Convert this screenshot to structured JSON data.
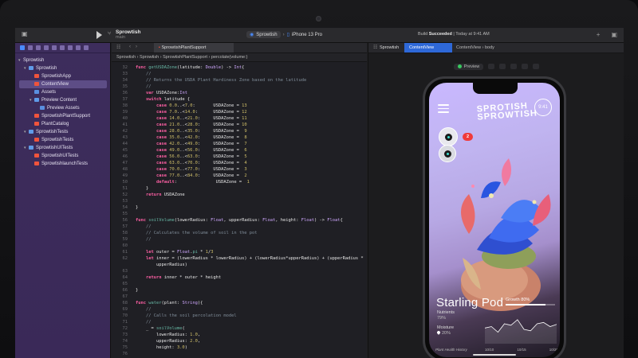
{
  "toolbar": {
    "project_name": "Sprowtish",
    "branch": "main",
    "scheme_target": "Sprowtish",
    "device": "iPhone 13 Pro",
    "status_prefix": "Build",
    "status_bold": "Succeeded",
    "status_suffix": "| Today at 9:41 AM"
  },
  "navigator": {
    "items": [
      {
        "label": "Sprowtish",
        "depth": 0,
        "icon": "project-icon",
        "disclosure": "▾"
      },
      {
        "label": "Sprowtish",
        "depth": 1,
        "icon": "folder-icon",
        "disclosure": "▾"
      },
      {
        "label": "SprowtishApp",
        "depth": 2,
        "icon": "swift-file-icon",
        "disclosure": ""
      },
      {
        "label": "ContentView",
        "depth": 2,
        "icon": "swift-file-icon",
        "disclosure": "",
        "selected": true
      },
      {
        "label": "Assets",
        "depth": 2,
        "icon": "assets-icon",
        "disclosure": ""
      },
      {
        "label": "Preview Content",
        "depth": 2,
        "icon": "folder-icon",
        "disclosure": "▾"
      },
      {
        "label": "Preview Assets",
        "depth": 3,
        "icon": "assets-icon",
        "disclosure": ""
      },
      {
        "label": "SprowtishPlantSupport",
        "depth": 2,
        "icon": "swift-file-icon",
        "disclosure": ""
      },
      {
        "label": "PlantCatalog",
        "depth": 2,
        "icon": "swift-file-icon",
        "disclosure": ""
      },
      {
        "label": "SprowtishTests",
        "depth": 1,
        "icon": "folder-icon",
        "disclosure": "▾"
      },
      {
        "label": "SprowtishTests",
        "depth": 2,
        "icon": "swift-file-icon",
        "disclosure": ""
      },
      {
        "label": "SprowtishUITests",
        "depth": 1,
        "icon": "folder-icon",
        "disclosure": "▾"
      },
      {
        "label": "SprowtishUITests",
        "depth": 2,
        "icon": "swift-file-icon",
        "disclosure": ""
      },
      {
        "label": "SprowtishlaunchTests",
        "depth": 2,
        "icon": "swift-file-icon",
        "disclosure": ""
      }
    ]
  },
  "editor": {
    "tab_label": "SprowtishPlantSupport",
    "jumpbar": "Sprowtish  ›  Sprowtish  ›  SprowtishPlantSupport  ›  percolate(volume:)",
    "lines": [
      {
        "n": "32",
        "html": "<span class='kw'>func</span> <span class='fn'>getUSDAZone</span>(latitude: <span class='ty'>Double</span>) -> <span class='ty'>Int</span>{"
      },
      {
        "n": "33",
        "html": "    <span class='cmt'>//</span>"
      },
      {
        "n": "34",
        "html": "    <span class='cmt'>// Returns the USDA Plant Hardiness Zone based on the latitude</span>"
      },
      {
        "n": "35",
        "html": "    <span class='cmt'>//</span>"
      },
      {
        "n": "36",
        "html": "    <span class='kw'>var</span> USDAZone:<span class='ty'>Int</span>"
      },
      {
        "n": "37",
        "html": "    <span class='kw'>switch</span> latitude {"
      },
      {
        "n": "38",
        "html": "        <span class='kw'>case</span> <span class='num'>0.0</span>..<<span class='num'>7.0</span>:       USDAZone = <span class='num'>13</span>"
      },
      {
        "n": "39",
        "html": "        <span class='kw'>case</span> <span class='num'>7.0</span>..<<span class='num'>14.0</span>:      USDAZone = <span class='num'>12</span>"
      },
      {
        "n": "40",
        "html": "        <span class='kw'>case</span> <span class='num'>14.0</span>..<<span class='num'>21.0</span>:     USDAZone = <span class='num'>11</span>"
      },
      {
        "n": "41",
        "html": "        <span class='kw'>case</span> <span class='num'>21.0</span>..<<span class='num'>28.0</span>:     USDAZone = <span class='num'>10</span>"
      },
      {
        "n": "42",
        "html": "        <span class='kw'>case</span> <span class='num'>28.0</span>..<<span class='num'>35.0</span>:     USDAZone =  <span class='num'>9</span>"
      },
      {
        "n": "43",
        "html": "        <span class='kw'>case</span> <span class='num'>35.0</span>..<<span class='num'>42.0</span>:     USDAZone =  <span class='num'>8</span>"
      },
      {
        "n": "44",
        "html": "        <span class='kw'>case</span> <span class='num'>42.0</span>..<<span class='num'>49.0</span>:     USDAZone =  <span class='num'>7</span>"
      },
      {
        "n": "45",
        "html": "        <span class='kw'>case</span> <span class='num'>49.0</span>..<<span class='num'>56.0</span>:     USDAZone =  <span class='num'>6</span>"
      },
      {
        "n": "46",
        "html": "        <span class='kw'>case</span> <span class='num'>56.0</span>..<<span class='num'>63.0</span>:     USDAZone =  <span class='num'>5</span>"
      },
      {
        "n": "47",
        "html": "        <span class='kw'>case</span> <span class='num'>63.0</span>..<<span class='num'>70.0</span>:     USDAZone =  <span class='num'>4</span>"
      },
      {
        "n": "48",
        "html": "        <span class='kw'>case</span> <span class='num'>70.0</span>..<<span class='num'>77.0</span>:     USDAZone =  <span class='num'>3</span>"
      },
      {
        "n": "49",
        "html": "        <span class='kw'>case</span> <span class='num'>77.0</span>..<<span class='num'>84.0</span>:     USDAZone =  <span class='num'>2</span>"
      },
      {
        "n": "50",
        "html": "        <span class='kw'>default</span>:               USDAZone =  <span class='num'>1</span>"
      },
      {
        "n": "51",
        "html": "    }"
      },
      {
        "n": "52",
        "html": "    <span class='kw'>return</span> USDAZone"
      },
      {
        "n": "53",
        "html": ""
      },
      {
        "n": "54",
        "html": "}"
      },
      {
        "n": "55",
        "html": ""
      },
      {
        "n": "56",
        "html": "<span class='kw'>func</span> <span class='fn'>soilVolume</span>(lowerRadius: <span class='ty'>Float</span>, upperRadius: <span class='ty'>Float</span>, height: <span class='ty'>Float</span>) -> <span class='ty'>Float</span>{"
      },
      {
        "n": "57",
        "html": "    <span class='cmt'>//</span>"
      },
      {
        "n": "58",
        "html": "    <span class='cmt'>// Calculates the volume of soil in the pot</span>"
      },
      {
        "n": "59",
        "html": "    <span class='cmt'>//</span>"
      },
      {
        "n": "60",
        "html": ""
      },
      {
        "n": "61",
        "html": "    <span class='kw'>let</span> outer = <span class='ty'>Float</span>.<span class='fn'>pi</span> * <span class='num'>1</span>/<span class='num'>3</span>"
      },
      {
        "n": "62",
        "html": "    <span class='kw'>let</span> inner = (lowerRadius * lowerRadius) + (lowerRadius*upperRadius) + (upperRadius *"
      },
      {
        "n": "",
        "html": "        upperRadius)"
      },
      {
        "n": "63",
        "html": ""
      },
      {
        "n": "64",
        "html": "    <span class='kw'>return</span> inner * outer * height"
      },
      {
        "n": "65",
        "html": ""
      },
      {
        "n": "66",
        "html": "}"
      },
      {
        "n": "67",
        "html": ""
      },
      {
        "n": "68",
        "html": "<span class='kw'>func</span> <span class='fn'>water</span>(plant: <span class='ty'>String</span>){"
      },
      {
        "n": "69",
        "html": "    <span class='cmt'>//</span>"
      },
      {
        "n": "70",
        "html": "    <span class='cmt'>// Calls the soil percolation model</span>"
      },
      {
        "n": "71",
        "html": "    <span class='cmt'>//</span>"
      },
      {
        "n": "72",
        "html": "    _ = <span class='fn'>soilVolume</span>("
      },
      {
        "n": "73",
        "html": "        lowerRadius: <span class='num'>1.0</span>,"
      },
      {
        "n": "74",
        "html": "        upperRadius: <span class='num'>2.0</span>,"
      },
      {
        "n": "75",
        "html": "        height: <span class='num'>3.0</span>)"
      },
      {
        "n": "76",
        "html": ""
      },
      {
        "n": "77",
        "html": "}"
      },
      {
        "n": "78",
        "html": ""
      }
    ]
  },
  "canvas": {
    "jump_root": "Sprowtish",
    "tab_label": "ContentView",
    "jump_tail": "ContentView  ›  body",
    "preview_label": "Preview"
  },
  "phone": {
    "logo_line1": "SPROTISH",
    "logo_line2": "SPROWTISH",
    "time": "9:41",
    "notification_count": "2",
    "pod_title": "Starling Pod",
    "growth_label": "Growth 80%",
    "growth_value": 0.8,
    "nutrients_label": "Nutrients",
    "nutrients_value": "79%",
    "moisture_label": "Moisture",
    "moisture_value": "20%",
    "history_label": "Plant Health History",
    "chart_x_labels": [
      "10/10",
      "10/15",
      "10/20"
    ],
    "sparkline": [
      0.45,
      0.5,
      0.3,
      0.6,
      0.55,
      0.75,
      0.4,
      0.35,
      0.6,
      0.65,
      0.5,
      0.58
    ]
  },
  "colors": {
    "accent": "#2e68d8",
    "build_success": "#39c960",
    "navigator_bg": "#3d2d5c",
    "badge_red": "#f03a3a"
  }
}
